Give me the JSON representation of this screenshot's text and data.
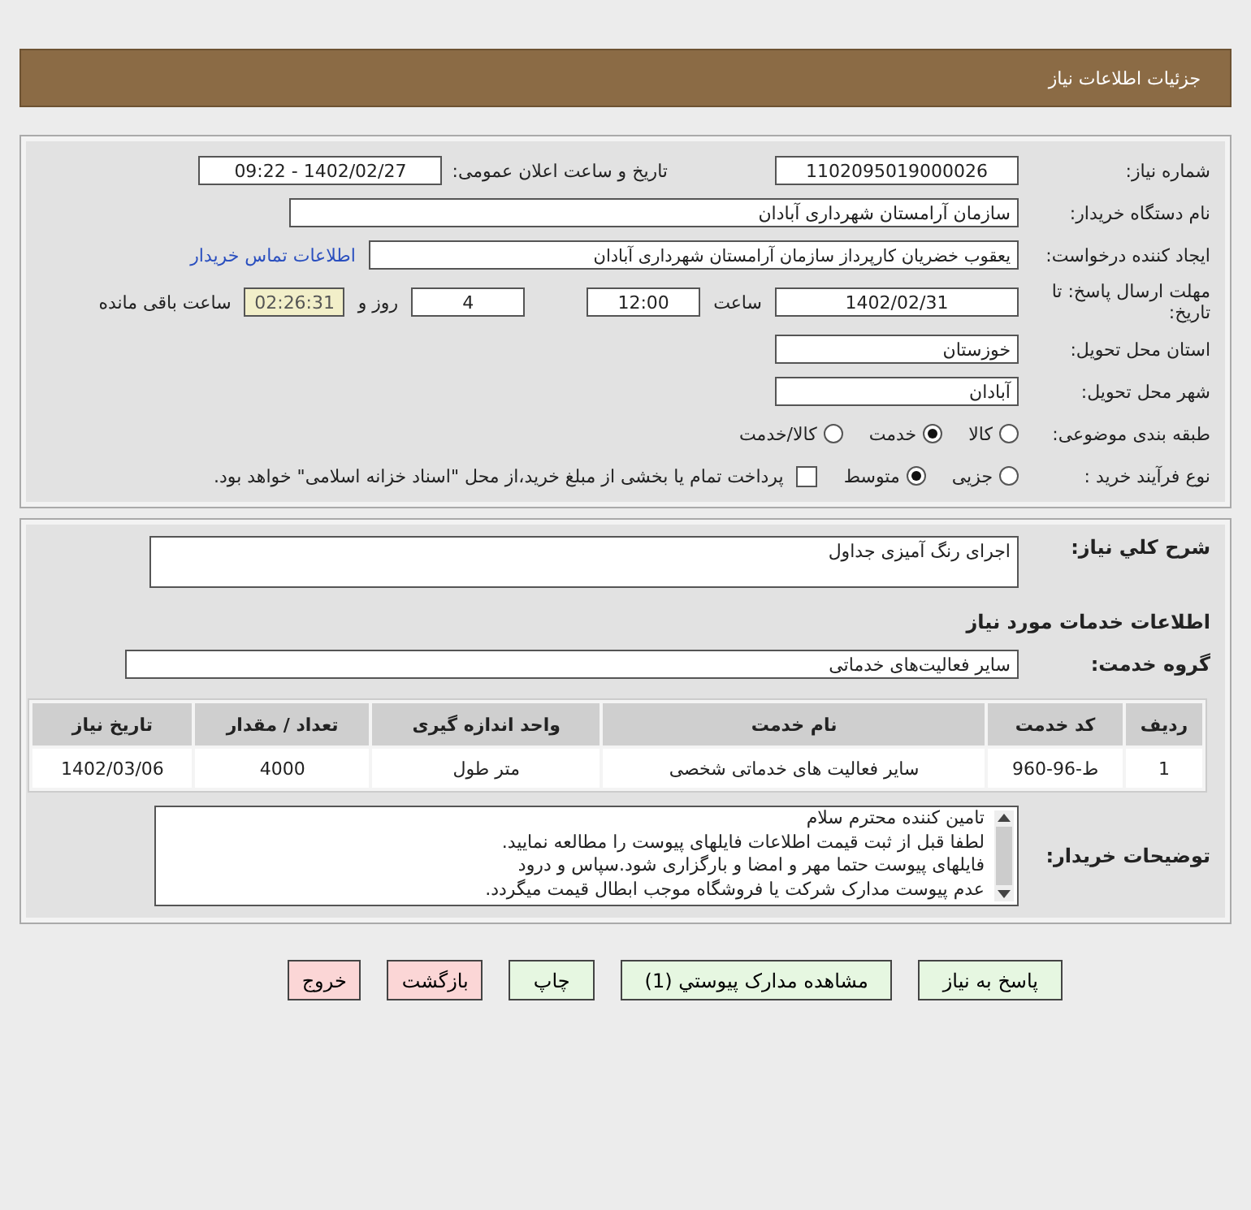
{
  "header": {
    "title": "جزئیات اطلاعات نیاز"
  },
  "details": {
    "need_number": {
      "label": "شماره نیاز:",
      "value": "1102095019000026"
    },
    "announce": {
      "label": "تاریخ و ساعت اعلان عمومی:",
      "value": "1402/02/27 - 09:22"
    },
    "buyer_org": {
      "label": "نام دستگاه خریدار:",
      "value": "سازمان آرامستان شهرداری آبادان"
    },
    "creator": {
      "label": "ایجاد کننده درخواست:",
      "value": "یعقوب خضریان کارپرداز سازمان آرامستان شهرداری آبادان",
      "link": "اطلاعات تماس خریدار"
    },
    "deadline": {
      "label": "مهلت ارسال پاسخ: تا تاریخ:",
      "date": "1402/02/31",
      "time_label": "ساعت",
      "time": "12:00",
      "days": "4",
      "days_label": "روز و",
      "remaining": "02:26:31",
      "remaining_label": "ساعت باقی مانده"
    },
    "province": {
      "label": "استان محل تحویل:",
      "value": "خوزستان"
    },
    "city": {
      "label": "شهر محل تحویل:",
      "value": "آبادان"
    },
    "category": {
      "label": "طبقه بندی موضوعی:",
      "options": [
        {
          "label": "کالا",
          "selected": false
        },
        {
          "label": "خدمت",
          "selected": true
        },
        {
          "label": "کالا/خدمت",
          "selected": false
        }
      ]
    },
    "process": {
      "label": "نوع فرآیند خرید :",
      "options": [
        {
          "label": "جزیی",
          "selected": false
        },
        {
          "label": "متوسط",
          "selected": true
        }
      ],
      "payment": {
        "label": "پرداخت تمام یا بخشی از مبلغ خرید،از محل \"اسناد خزانه اسلامی\" خواهد بود.",
        "checked": false
      }
    }
  },
  "services": {
    "summary": {
      "label": "شرح کلي نياز:",
      "value": "اجرای رنگ آمیزی جداول"
    },
    "heading": "اطلاعات خدمات مورد نیاز",
    "group": {
      "label": "گروه خدمت:",
      "value": "سایر فعالیت‌های خدماتی"
    },
    "table": {
      "columns": [
        "ردیف",
        "کد خدمت",
        "نام خدمت",
        "واحد اندازه گیری",
        "تعداد / مقدار",
        "تاریخ نیاز"
      ],
      "rows": [
        [
          "1",
          "ط-96-960",
          "سایر فعالیت های خدماتی شخصی",
          "متر طول",
          "4000",
          "1402/03/06"
        ]
      ]
    },
    "notes": {
      "label": "توضیحات خریدار:",
      "lines": [
        "تامین کننده محترم سلام",
        "لطفا قبل از ثبت قیمت اطلاعات فایلهای پیوست را مطالعه نمایید.",
        "فایلهای پیوست حتما مهر و امضا و بارگزاری شود.سپاس و درود",
        "عدم پیوست مدارک شرکت یا فروشگاه موجب ابطال قیمت میگردد."
      ]
    }
  },
  "buttons": [
    {
      "label": "پاسخ به نیاز",
      "kind": "primary"
    },
    {
      "label": "مشاهده مدارک پیوستي (1)",
      "kind": "primary"
    },
    {
      "label": "چاپ",
      "kind": "primary"
    },
    {
      "label": "بازگشت",
      "kind": "danger"
    },
    {
      "label": "خروج",
      "kind": "danger"
    }
  ]
}
